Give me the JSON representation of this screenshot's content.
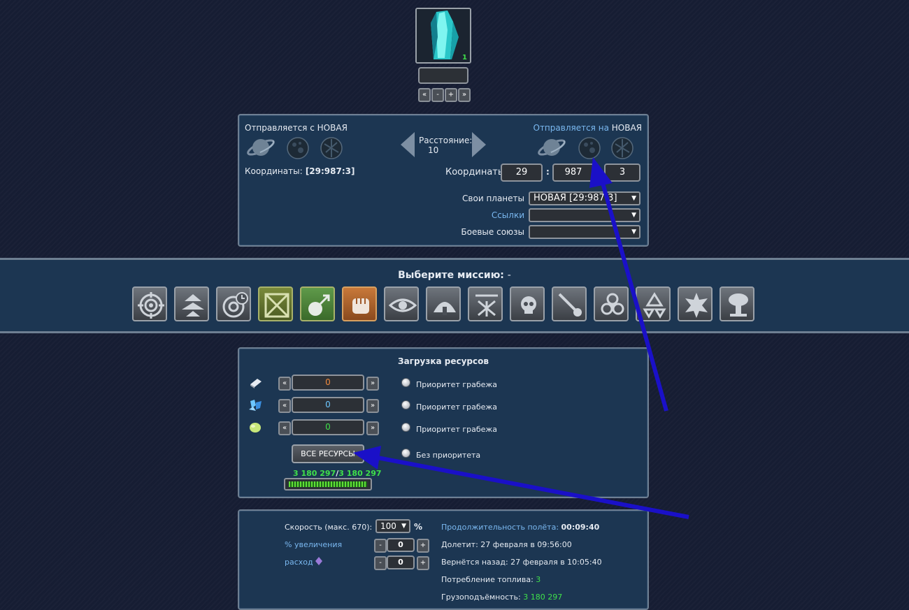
{
  "ship": {
    "count": "1",
    "name_value": ""
  },
  "stepper_labels": {
    "min": "«",
    "minus": "-",
    "plus": "+",
    "max": "»"
  },
  "route": {
    "from_label": "Отправляется с",
    "from_planet": "НОВАЯ",
    "to_label": "Отправляется на",
    "to_planet": "НОВАЯ",
    "distance_label": "Расстояние:",
    "distance_value": "10",
    "coords_label": "Координаты:",
    "from_coords": "[29:987:3]",
    "to_galaxy": "29",
    "to_system": "987",
    "to_position": "3",
    "separator": ":",
    "own_planets_label": "Свои планеты",
    "own_planets_value": "НОВАЯ [29:987:3]",
    "links_label": "Ссылки",
    "links_value": "",
    "alliances_label": "Боевые союзы",
    "alliances_value": ""
  },
  "mission": {
    "title": "Выберите миссию:",
    "selected": "-",
    "icons": [
      "attack-icon",
      "transport-up-icon",
      "timed-attack-icon",
      "deploy-crate-icon",
      "colonize-icon",
      "hold-fist-icon",
      "spy-eye-icon",
      "dome-icon",
      "destroy-rays-icon",
      "skull-icon",
      "meteor-icon",
      "biohazard-icon",
      "recycle-icon",
      "fist-burst-icon",
      "nuke-icon"
    ]
  },
  "resources": {
    "title": "Загрузка ресурсов",
    "rows": [
      {
        "icon": "metal-icon",
        "value": "0",
        "priority": "Приоритет грабежа",
        "color": "#f08a3c"
      },
      {
        "icon": "crystal-icon",
        "value": "0",
        "priority": "Приоритет грабежа",
        "color": "#6cc6ff"
      },
      {
        "icon": "deuterium-icon",
        "value": "0",
        "priority": "Приоритет грабежа",
        "color": "#3fe04a"
      }
    ],
    "all_button": "ВСЕ РЕСУРСЫ",
    "no_priority": "Без приоритета",
    "capacity_used": "3 180 297",
    "capacity_sep": "/",
    "capacity_total": "3 180 297",
    "capacity_fill": 1.0
  },
  "flight": {
    "speed_label": "Скорость (макс. 670):",
    "speed_value": "100",
    "speed_unit": "%",
    "increase_label": "% увеличения",
    "increase_value": "0",
    "consumption_label": "расход",
    "consumption_value": "0",
    "duration_label": "Продолжительность полёта:",
    "duration_value": "00:09:40",
    "arrive_label": "Долетит:",
    "arrive_value": "27 февраля в 09:56:00",
    "return_label": "Вернётся назад:",
    "return_value": "27 февраля в 10:05:40",
    "fuel_label": "Потребление топлива:",
    "fuel_value": "3",
    "cargo_label": "Грузоподъёмность:",
    "cargo_value": "3 180 297"
  },
  "colors": {
    "panel": "#1c3652",
    "accent_blue": "#7ab8f0",
    "green": "#3fe04a",
    "annotation_arrow": "#1a10c8"
  }
}
